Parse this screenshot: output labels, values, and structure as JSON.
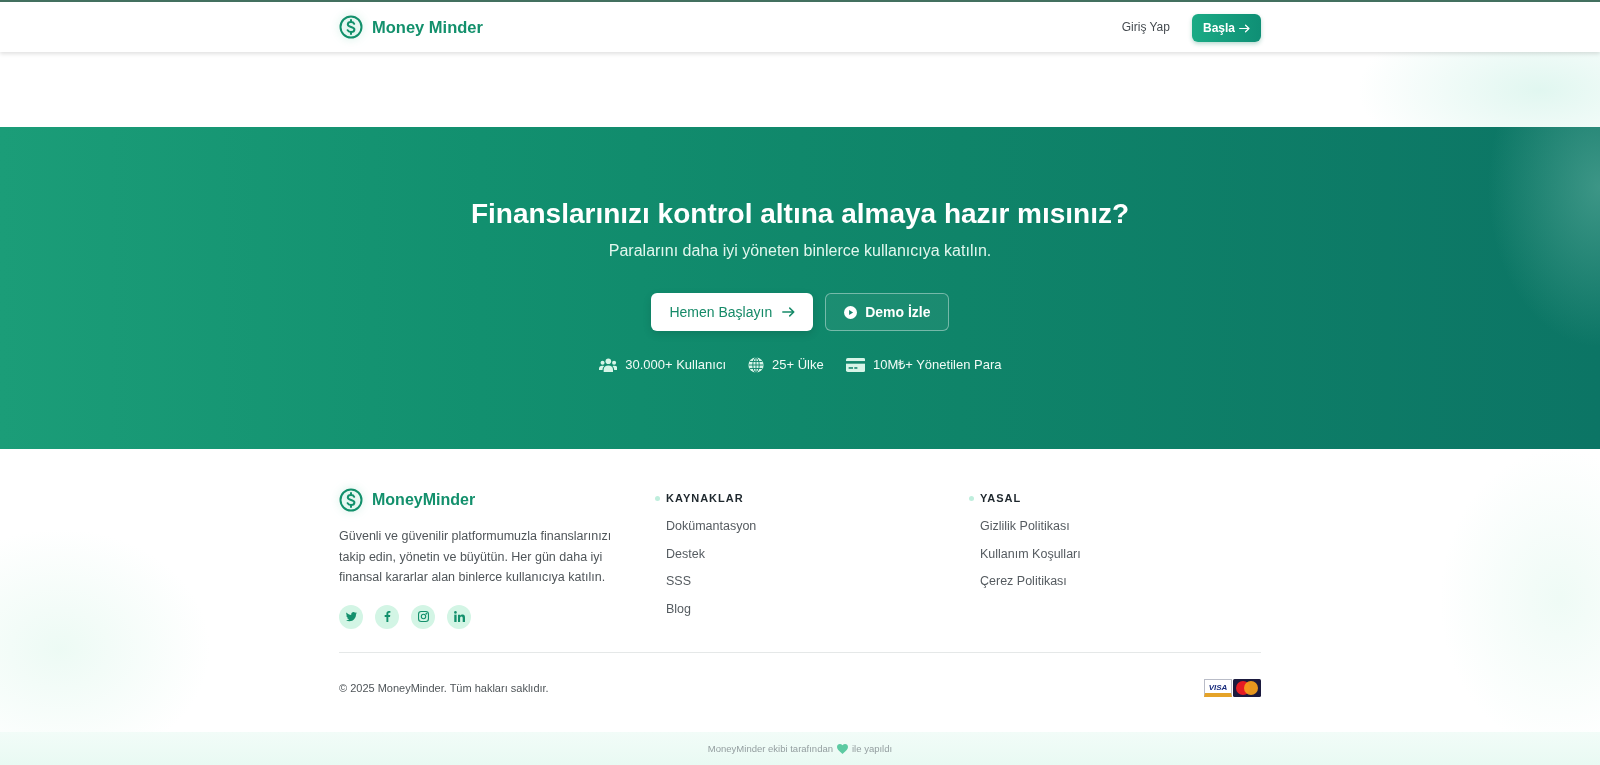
{
  "header": {
    "brand": "Money Minder",
    "login_link": "Giriş Yap",
    "cta_button": "Başla"
  },
  "hero": {
    "title": "Finanslarınızı kontrol altına almaya hazır mısınız?",
    "subtitle": "Paralarını daha iyi yöneten binlerce kullanıcıya katılın.",
    "buttons": [
      {
        "label": "Hemen Başlayın",
        "kind": "primary"
      },
      {
        "label": "Demo İzle",
        "kind": "outline"
      }
    ],
    "stats": [
      {
        "kind": "users",
        "label": "30.000+ Kullanıcı"
      },
      {
        "kind": "globe",
        "label": "25+ Ülke"
      },
      {
        "kind": "card",
        "label": "10M₺+ Yönetilen Para"
      }
    ]
  },
  "footer": {
    "brand": "MoneyMinder",
    "description": "Güvenli ve güvenilir platformumuzla finanslarınızı takip edin, yönetin ve büyütün. Her gün daha iyi finansal kararlar alan binlerce kullanıcıya katılın.",
    "social": [
      {
        "kind": "twitter"
      },
      {
        "kind": "facebook"
      },
      {
        "kind": "instagram"
      },
      {
        "kind": "linkedin"
      }
    ],
    "columns": [
      {
        "title": "KAYNAKLAR",
        "links": [
          "Dokümantasyon",
          "Destek",
          "SSS",
          "Blog"
        ]
      },
      {
        "title": "YASAL",
        "links": [
          "Gizlilik Politikası",
          "Kullanım Koşulları",
          "Çerez Politikası"
        ]
      }
    ],
    "copyright": "© 2025 MoneyMinder. Tüm hakları saklıdır.",
    "payment_cards": [
      {
        "kind": "visa",
        "label": "VISA"
      },
      {
        "kind": "mastercard"
      }
    ]
  },
  "credit": {
    "before": "MoneyMinder ekibi tarafından",
    "after": "ile yapıldı"
  }
}
